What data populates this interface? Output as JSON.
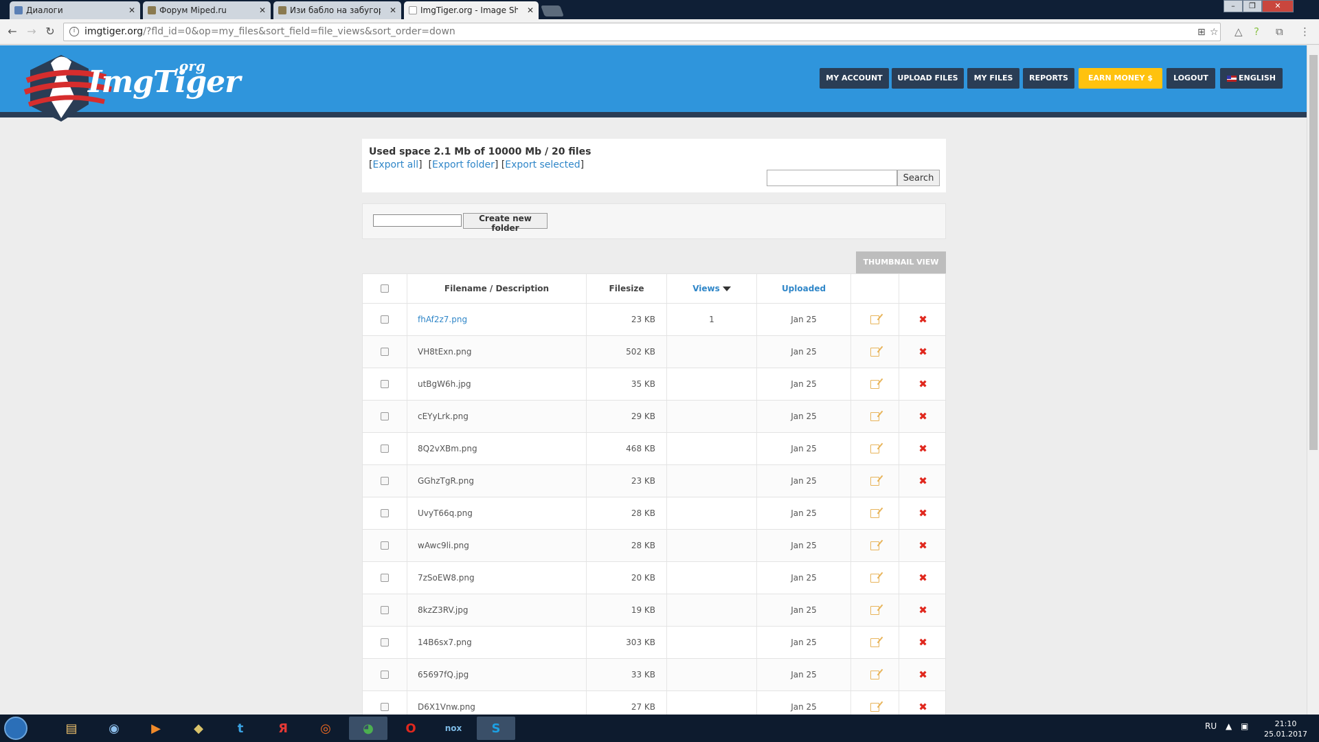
{
  "browser": {
    "tabs": [
      {
        "title": "Диалоги"
      },
      {
        "title": "Форум Miped.ru"
      },
      {
        "title": "Изи бабло на забугорн"
      },
      {
        "title": "ImgTiger.org - Image Sh"
      }
    ],
    "url_host": "imgtiger.org",
    "url_path": "/?fld_id=0&op=my_files&sort_field=file_views&sort_order=down"
  },
  "site": {
    "logo_text": "ImgTiger",
    "logo_suffix": ".org",
    "nav": [
      {
        "label": "MY ACCOUNT"
      },
      {
        "label": "UPLOAD FILES"
      },
      {
        "label": "MY FILES"
      },
      {
        "label": "REPORTS"
      },
      {
        "label": "EARN MONEY  $"
      },
      {
        "label": "LOGOUT"
      },
      {
        "label": "ENGLISH"
      }
    ],
    "colors": {
      "header": "#2f95dc",
      "nav": "#2a3d55",
      "earn": "#ffc20e",
      "link": "#2f86c8",
      "delete": "#e0281e"
    }
  },
  "files_page": {
    "used_space": "Used space 2.1 Mb of 10000 Mb / 20 files",
    "export_all": "Export all",
    "export_folder": "Export folder",
    "export_selected": "Export selected",
    "search_button": "Search",
    "create_folder_button": "Create new folder",
    "thumbnail_view": "THUMBNAIL VIEW",
    "columns": {
      "filename": "Filename / Description",
      "filesize": "Filesize",
      "views": "Views",
      "uploaded": "Uploaded"
    },
    "rows": [
      {
        "name": "fhAf2z7.png",
        "size": "23 KB",
        "views": "1",
        "date": "Jan 25",
        "link": true
      },
      {
        "name": "VH8tExn.png",
        "size": "502 KB",
        "views": "",
        "date": "Jan 25"
      },
      {
        "name": "utBgW6h.jpg",
        "size": "35 KB",
        "views": "",
        "date": "Jan 25"
      },
      {
        "name": "cEYyLrk.png",
        "size": "29 KB",
        "views": "",
        "date": "Jan 25"
      },
      {
        "name": "8Q2vXBm.png",
        "size": "468 KB",
        "views": "",
        "date": "Jan 25"
      },
      {
        "name": "GGhzTgR.png",
        "size": "23 KB",
        "views": "",
        "date": "Jan 25"
      },
      {
        "name": "UvyT66q.png",
        "size": "28 KB",
        "views": "",
        "date": "Jan 25"
      },
      {
        "name": "wAwc9li.png",
        "size": "28 KB",
        "views": "",
        "date": "Jan 25"
      },
      {
        "name": "7zSoEW8.png",
        "size": "20 KB",
        "views": "",
        "date": "Jan 25"
      },
      {
        "name": "8kzZ3RV.jpg",
        "size": "19 KB",
        "views": "",
        "date": "Jan 25"
      },
      {
        "name": "14B6sx7.png",
        "size": "303 KB",
        "views": "",
        "date": "Jan 25"
      },
      {
        "name": "65697fQ.jpg",
        "size": "33 KB",
        "views": "",
        "date": "Jan 25"
      },
      {
        "name": "D6X1Vnw.png",
        "size": "27 KB",
        "views": "",
        "date": "Jan 25"
      }
    ]
  },
  "taskbar": {
    "language": "RU",
    "time": "21:10",
    "date": "25.01.2017"
  }
}
